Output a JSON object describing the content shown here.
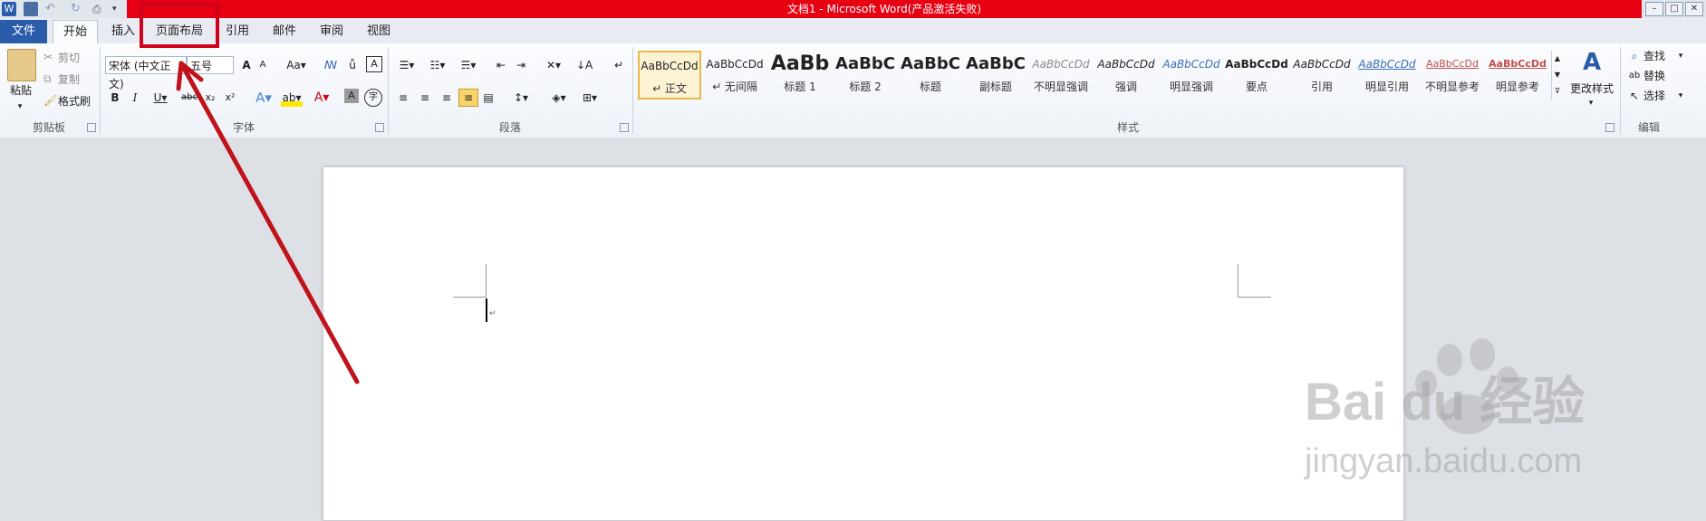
{
  "window": {
    "title": "文档1 - Microsoft Word(产品激活失败)"
  },
  "tabs": {
    "file": "文件",
    "home": "开始",
    "insert": "插入",
    "page_layout": "页面布局",
    "references": "引用",
    "mailings": "邮件",
    "review": "审阅",
    "view": "视图"
  },
  "clipboard": {
    "paste": "粘贴",
    "cut": "剪切",
    "copy": "复制",
    "format_painter": "格式刷",
    "group_label": "剪贴板"
  },
  "font": {
    "font_name": "宋体 (中文正文)",
    "font_size": "五号",
    "group_label": "字体"
  },
  "paragraph": {
    "group_label": "段落"
  },
  "styles": {
    "group_label": "样式",
    "items": [
      {
        "sample": "AaBbCcDd",
        "label": "↵ 正文"
      },
      {
        "sample": "AaBbCcDd",
        "label": "↵ 无间隔"
      },
      {
        "sample": "AaBb",
        "label": "标题 1"
      },
      {
        "sample": "AaBbC",
        "label": "标题 2"
      },
      {
        "sample": "AaBbC",
        "label": "标题"
      },
      {
        "sample": "AaBbC",
        "label": "副标题"
      },
      {
        "sample": "AaBbCcDd",
        "label": "不明显强调"
      },
      {
        "sample": "AaBbCcDd",
        "label": "强调"
      },
      {
        "sample": "AaBbCcDd",
        "label": "明显强调"
      },
      {
        "sample": "AaBbCcDd",
        "label": "要点"
      },
      {
        "sample": "AaBbCcDd",
        "label": "引用"
      },
      {
        "sample": "AaBbCcDd",
        "label": "明显引用"
      },
      {
        "sample": "AaBbCcDd",
        "label": "不明显参考"
      },
      {
        "sample": "AaBbCcDd",
        "label": "明显参考"
      }
    ],
    "change_styles": "更改样式"
  },
  "editing": {
    "find": "查找",
    "replace": "替换",
    "select": "选择",
    "group_label": "编辑"
  },
  "watermark": {
    "brand": "Bai du 经验",
    "url": "jingyan.baidu.com"
  },
  "colors": {
    "title_red": "#e60012",
    "annotation_red": "#c0121b",
    "file_tab_blue": "#2a5caa"
  }
}
